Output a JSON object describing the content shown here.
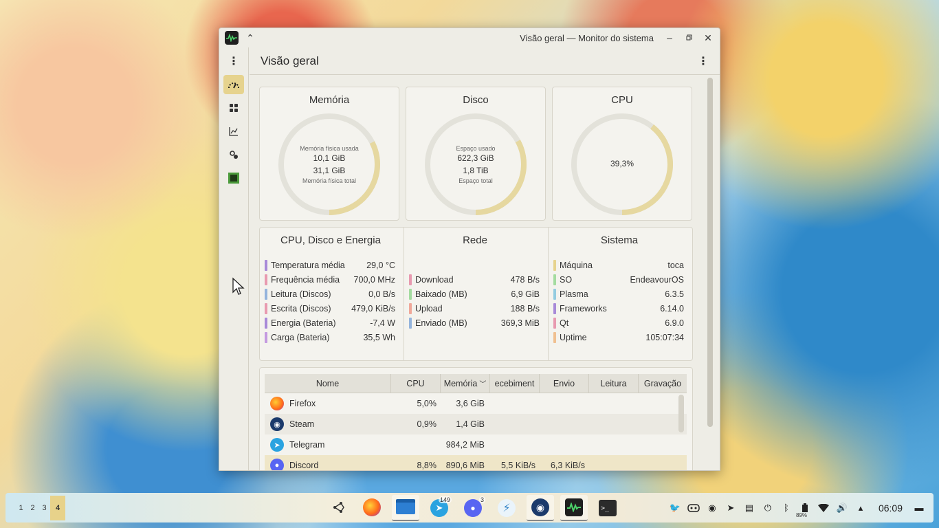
{
  "window": {
    "title": "Visão geral — Monitor do sistema",
    "page_title": "Visão geral"
  },
  "sidebar": {
    "items": [
      {
        "icon": "speedometer-icon",
        "active": true
      },
      {
        "icon": "apps-grid-icon",
        "active": false
      },
      {
        "icon": "chart-icon",
        "active": false
      },
      {
        "icon": "gears-icon",
        "active": false
      },
      {
        "icon": "chip-icon",
        "active": false
      }
    ]
  },
  "cards": {
    "memory": {
      "title": "Memória",
      "top_label": "Memória física usada",
      "used": "10,1 GiB",
      "total": "31,1 GiB",
      "bottom_label": "Memória física total",
      "fraction": 0.325
    },
    "disk": {
      "title": "Disco",
      "top_label": "Espaço usado",
      "used": "622,3 GiB",
      "total": "1,8 TiB",
      "bottom_label": "Espaço total",
      "fraction": 0.33
    },
    "cpu": {
      "title": "CPU",
      "value": "39,3%",
      "fraction": 0.393
    }
  },
  "info": {
    "cpu_disk_energy": {
      "title": "CPU, Disco e Energia",
      "rows": [
        {
          "label": "Temperatura média",
          "value": "29,0 °C",
          "color": "#a88ad8"
        },
        {
          "label": "Frequência média",
          "value": "700,0 MHz",
          "color": "#e89ab0"
        },
        {
          "label": "Leitura (Discos)",
          "value": "0,0 B/s",
          "color": "#94b4dc"
        },
        {
          "label": "Escrita (Discos)",
          "value": "479,0 KiB/s",
          "color": "#e89ab0"
        },
        {
          "label": "Energia (Bateria)",
          "value": "-7,4 W",
          "color": "#a88ad8"
        },
        {
          "label": "Carga (Bateria)",
          "value": "35,5 Wh",
          "color": "#c49ae0"
        }
      ]
    },
    "network": {
      "title": "Rede",
      "rows": [
        {
          "label": "Download",
          "value": "478 B/s",
          "color": "#e89ab0"
        },
        {
          "label": "Baixado (MB)",
          "value": "6,9 GiB",
          "color": "#a4dca0"
        },
        {
          "label": "Upload",
          "value": "188 B/s",
          "color": "#f0a89a"
        },
        {
          "label": "Enviado (MB)",
          "value": "369,3 MiB",
          "color": "#94b4dc"
        }
      ]
    },
    "system": {
      "title": "Sistema",
      "rows": [
        {
          "label": "Máquina",
          "value": "toca",
          "color": "#e6d38e"
        },
        {
          "label": "SO",
          "value": "EndeavourOS",
          "color": "#a4dca0"
        },
        {
          "label": "Plasma",
          "value": "6.3.5",
          "color": "#94cce0"
        },
        {
          "label": "Frameworks",
          "value": "6.14.0",
          "color": "#a88ad8"
        },
        {
          "label": "Qt",
          "value": "6.9.0",
          "color": "#e89ab0"
        },
        {
          "label": "Uptime",
          "value": "105:07:34",
          "color": "#f0c090"
        }
      ]
    }
  },
  "processes": {
    "columns": [
      "Nome",
      "CPU",
      "Memória",
      "ecebiment",
      "Envio",
      "Leitura",
      "Gravação"
    ],
    "rows": [
      {
        "name": "Firefox",
        "icon": "firefox-icon",
        "cpu": "5,0%",
        "mem": "3,6 GiB",
        "recv": "",
        "send": "",
        "read": "",
        "write": ""
      },
      {
        "name": "Steam",
        "icon": "steam-icon",
        "cpu": "0,9%",
        "mem": "1,4 GiB",
        "recv": "",
        "send": "",
        "read": "",
        "write": ""
      },
      {
        "name": "Telegram",
        "icon": "telegram-icon",
        "cpu": "",
        "mem": "984,2 MiB",
        "recv": "",
        "send": "",
        "read": "",
        "write": ""
      },
      {
        "name": "Discord",
        "icon": "discord-icon",
        "cpu": "8,8%",
        "mem": "890,6 MiB",
        "recv": "5,5 KiB/s",
        "send": "6,3 KiB/s",
        "read": "",
        "write": ""
      }
    ]
  },
  "taskbar": {
    "desktops": [
      "1",
      "2",
      "3",
      "4"
    ],
    "current_desktop": "4",
    "tasks": [
      {
        "name": "git-icon",
        "badge": ""
      },
      {
        "name": "firefox-icon",
        "badge": ""
      },
      {
        "name": "files-icon",
        "badge": ""
      },
      {
        "name": "telegram-icon",
        "badge": "149"
      },
      {
        "name": "discord-icon",
        "badge": "3"
      },
      {
        "name": "kdeconnect-icon",
        "badge": ""
      },
      {
        "name": "steam-icon",
        "badge": ""
      },
      {
        "name": "system-monitor-icon",
        "badge": ""
      },
      {
        "name": "terminal-icon",
        "badge": ""
      }
    ],
    "battery": "89%",
    "clock": "06:09"
  }
}
